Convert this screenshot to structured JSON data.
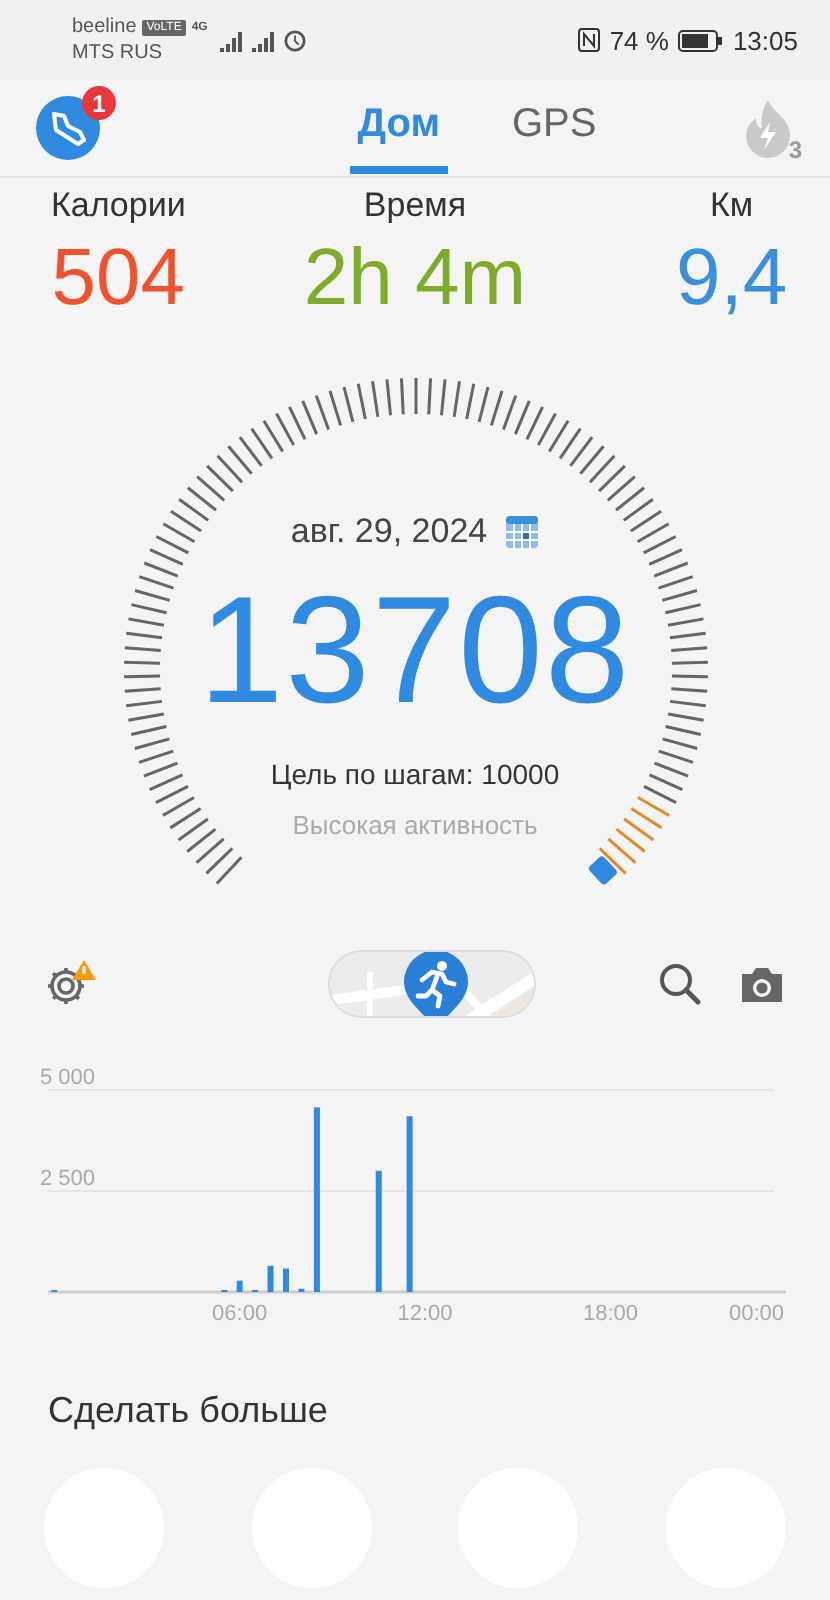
{
  "status_bar": {
    "carriers": [
      {
        "name": "beeline",
        "badge": "VoLTE",
        "network": "4G"
      },
      {
        "name": "MTS RUS"
      }
    ],
    "battery": "74 %",
    "time": "13:05"
  },
  "header": {
    "notification_count": "1",
    "tabs": [
      {
        "label": "Дом",
        "selected": true
      },
      {
        "label": "GPS",
        "selected": false
      }
    ],
    "streak_count": "3"
  },
  "stats": [
    {
      "label": "Калории",
      "value": "504",
      "color": "#f0522d"
    },
    {
      "label": "Время",
      "value": "2h 4m",
      "color": "#7cac2a"
    },
    {
      "label": "Км",
      "value": "9,4",
      "color": "#3a8fdc"
    }
  ],
  "gauge": {
    "date": "авг. 29, 2024",
    "steps": "13708",
    "goal": "Цель по шагам: 10000",
    "activity": "Высокая активность"
  },
  "chart_data": {
    "type": "bar",
    "x": [
      0,
      5.5,
      6,
      6.5,
      7,
      7.5,
      8,
      8.5,
      10.5,
      11.5
    ],
    "series": [
      {
        "color": "#2f8ae0",
        "values": [
          50,
          50,
          280,
          50,
          650,
          580,
          80,
          4570,
          3000,
          4350
        ]
      }
    ],
    "xlim": [
      -0.2,
      24
    ],
    "ylim": [
      0,
      5000
    ],
    "xticks": [
      {
        "value": 6,
        "label": "06:00"
      },
      {
        "value": 12,
        "label": "12:00"
      },
      {
        "value": 18,
        "label": "18:00"
      },
      {
        "value": 24,
        "label": "00:00"
      }
    ],
    "yticks": [
      {
        "value": 2500,
        "label": "2 500"
      },
      {
        "value": 5000,
        "label": "5 000"
      }
    ]
  },
  "more": {
    "title": "Сделать больше"
  }
}
